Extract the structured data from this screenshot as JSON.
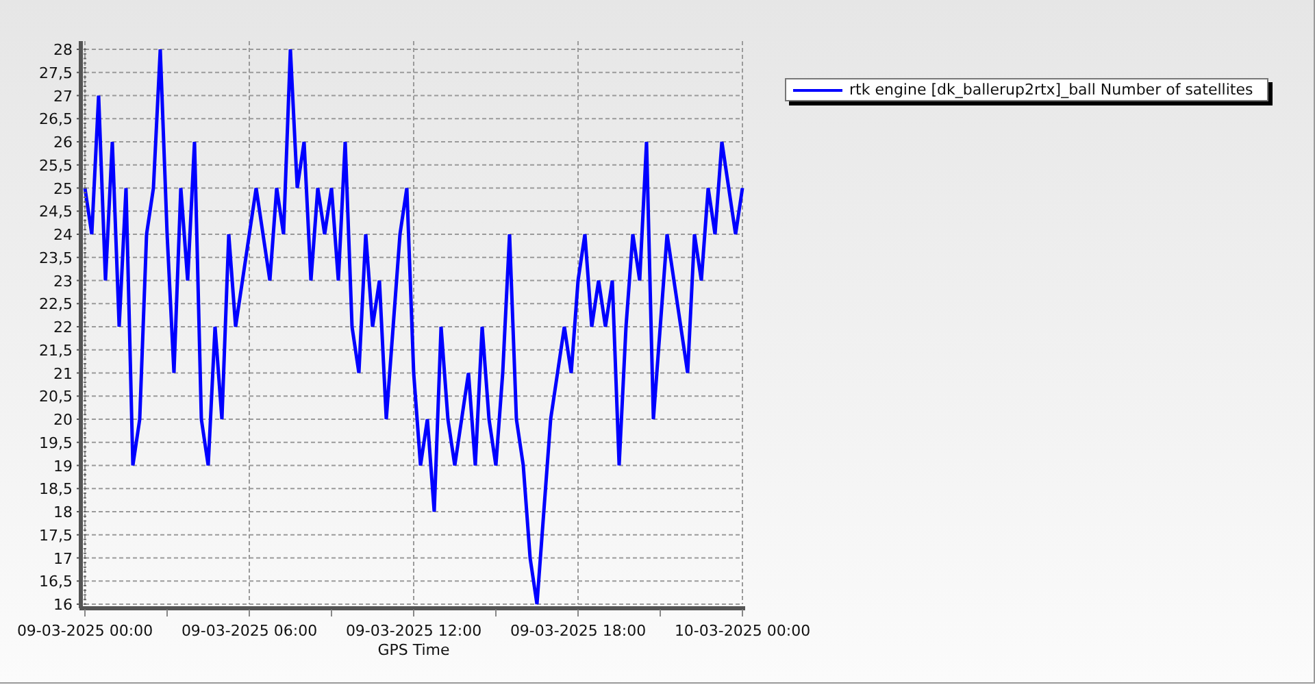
{
  "chart": {
    "chart_data": {
      "type": "line",
      "xlabel": "GPS Time",
      "categories": [
        "09-03-2025 00:00",
        null,
        null,
        null,
        null,
        null,
        null,
        null,
        null,
        null,
        null,
        null,
        null,
        null,
        null,
        null,
        null,
        null,
        null,
        null,
        null,
        null,
        null,
        null,
        "09-03-2025 06:00",
        null,
        null,
        null,
        null,
        null,
        null,
        null,
        null,
        null,
        null,
        null,
        null,
        null,
        null,
        null,
        null,
        null,
        null,
        null,
        null,
        null,
        null,
        null,
        "09-03-2025 12:00",
        null,
        null,
        null,
        null,
        null,
        null,
        null,
        null,
        null,
        null,
        null,
        null,
        null,
        null,
        null,
        null,
        null,
        null,
        null,
        null,
        null,
        null,
        null,
        "09-03-2025 18:00",
        null,
        null,
        null,
        null,
        null,
        null,
        null,
        null,
        null,
        null,
        null,
        null,
        null,
        null,
        null,
        null,
        null,
        null,
        null,
        null,
        null,
        null,
        null,
        "10-03-2025 00:00"
      ],
      "series": [
        {
          "name": "rtk engine [dk_ballerup2rtx]_ball Number of satellites",
          "color": "#0000ff",
          "values": [
            25,
            24,
            27,
            23,
            26,
            22,
            25,
            19,
            20,
            24,
            25,
            28,
            24,
            21,
            25,
            23,
            26,
            20,
            19,
            22,
            20,
            24,
            22,
            23,
            24,
            25,
            24,
            23,
            25,
            24,
            28,
            25,
            26,
            23,
            25,
            24,
            25,
            23,
            26,
            22,
            21,
            24,
            22,
            23,
            20,
            22,
            24,
            25,
            21,
            19,
            20,
            18,
            22,
            20,
            19,
            20,
            21,
            19,
            22,
            20,
            19,
            21,
            24,
            20,
            19,
            17,
            16,
            18,
            20,
            21,
            22,
            21,
            23,
            24,
            22,
            23,
            22,
            23,
            19,
            22,
            24,
            23,
            26,
            20,
            22,
            24,
            23,
            22,
            21,
            24,
            23,
            25,
            24,
            26,
            25,
            24,
            25
          ]
        }
      ],
      "ylim": [
        16,
        28
      ],
      "grid": true,
      "yticks": [
        {
          "value": 16,
          "label": "16"
        },
        {
          "value": 16.5,
          "label": "16,5"
        },
        {
          "value": 17,
          "label": "17"
        },
        {
          "value": 17.5,
          "label": "17,5"
        },
        {
          "value": 18,
          "label": "18"
        },
        {
          "value": 18.5,
          "label": "18,5"
        },
        {
          "value": 19,
          "label": "19"
        },
        {
          "value": 19.5,
          "label": "19,5"
        },
        {
          "value": 20,
          "label": "20"
        },
        {
          "value": 20.5,
          "label": "20,5"
        },
        {
          "value": 21,
          "label": "21"
        },
        {
          "value": 21.5,
          "label": "21,5"
        },
        {
          "value": 22,
          "label": "22"
        },
        {
          "value": 22.5,
          "label": "22,5"
        },
        {
          "value": 23,
          "label": "23"
        },
        {
          "value": 23.5,
          "label": "23,5"
        },
        {
          "value": 24,
          "label": "24"
        },
        {
          "value": 24.5,
          "label": "24,5"
        },
        {
          "value": 25,
          "label": "25"
        },
        {
          "value": 25.5,
          "label": "25,5"
        },
        {
          "value": 26,
          "label": "26"
        },
        {
          "value": 26.5,
          "label": "26,5"
        },
        {
          "value": 27,
          "label": "27"
        },
        {
          "value": 27.5,
          "label": "27,5"
        },
        {
          "value": 28,
          "label": "28"
        }
      ]
    }
  }
}
